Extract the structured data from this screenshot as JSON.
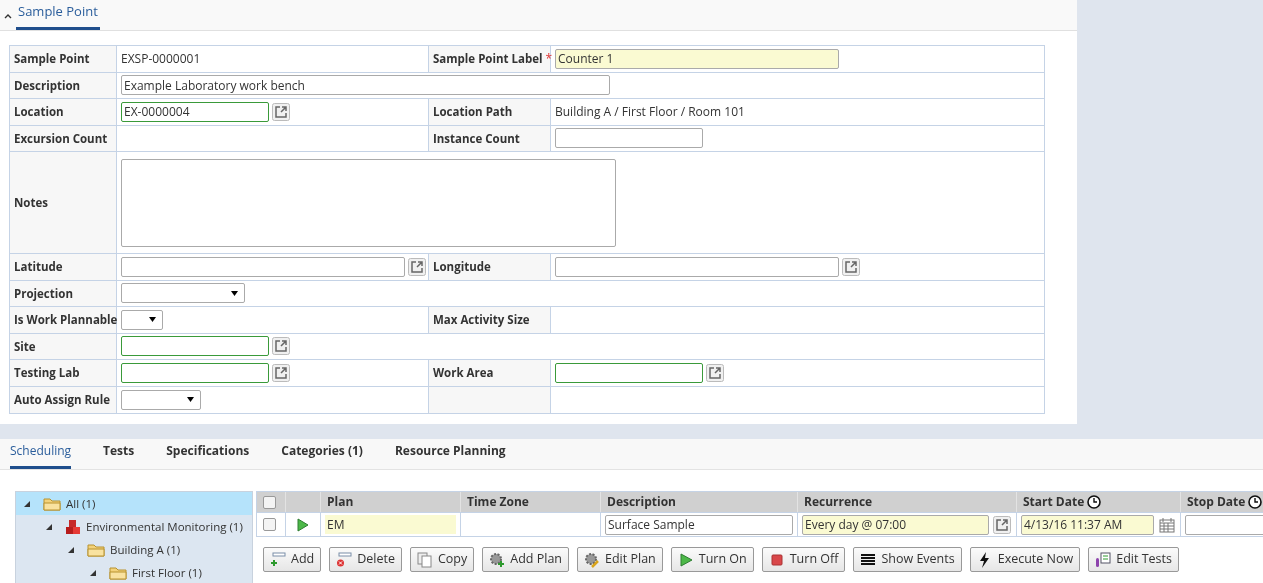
{
  "section": {
    "title": "Sample Point",
    "expanded": true
  },
  "form_rows": [
    {
      "full_width": false,
      "fields": [
        {
          "label": "Sample Point",
          "kind": "text",
          "value": "EXSP-0000001"
        },
        {
          "label": "Sample Point Label",
          "required_mark": "*",
          "kind": "wideinput",
          "value": "Counter 1",
          "required": true
        }
      ]
    },
    {
      "full_width": true,
      "fields": [
        {
          "label": "Description",
          "kind": "fullinput",
          "value": "Example Laboratory work bench"
        }
      ]
    },
    {
      "full_width": false,
      "fields": [
        {
          "label": "Location",
          "kind": "input",
          "value": "EX-0000004",
          "linked": true,
          "link_button": true
        },
        {
          "label": "Location Path",
          "kind": "text",
          "value": "Building A / First Floor / Room 101"
        }
      ]
    },
    {
      "full_width": false,
      "fields": [
        {
          "label": "Excursion Count",
          "kind": "text"
        },
        {
          "label": "Instance Count",
          "kind": "input"
        }
      ]
    },
    {
      "full_width": true,
      "fields": [
        {
          "label": "Notes",
          "kind": "memo"
        }
      ]
    },
    {
      "full_width": false,
      "fields": [
        {
          "label": "Latitude",
          "kind": "wideinput",
          "link_button": true
        },
        {
          "label": "Longitude",
          "kind": "wideinput",
          "link_button": true
        }
      ]
    },
    {
      "full_width": true,
      "fields": [
        {
          "label": "Projection",
          "kind": "select"
        }
      ]
    },
    {
      "full_width": false,
      "fields": [
        {
          "label": "Is Work Plannable",
          "kind": "shortselect"
        },
        {
          "label": "Max Activity Size",
          "kind": "text"
        }
      ]
    },
    {
      "full_width": true,
      "fields": [
        {
          "label": "Site",
          "kind": "input",
          "linked": true,
          "link_button": true
        }
      ]
    },
    {
      "full_width": false,
      "fields": [
        {
          "label": "Testing Lab",
          "kind": "input",
          "linked": true,
          "link_button": true
        },
        {
          "label": "Work Area",
          "kind": "input",
          "linked": true,
          "link_button": true
        }
      ]
    },
    {
      "full_width": false,
      "fields": [
        {
          "label": "Auto Assign Rule",
          "kind": "midselect"
        }
      ]
    }
  ],
  "tabs": [
    {
      "label": "Scheduling",
      "selected": true
    },
    {
      "label": "Tests",
      "selected": false
    },
    {
      "label": "Specifications",
      "selected": false
    },
    {
      "label": "Categories (1)",
      "selected": false
    },
    {
      "label": "Resource Planning",
      "selected": false
    }
  ],
  "tree": [
    {
      "label": "All (1)",
      "kind": "folder",
      "selected": true,
      "expanded": true,
      "children": [
        {
          "label": "Environmental Monitoring (1)",
          "kind": "cubes",
          "selected": false,
          "expanded": true,
          "children": [
            {
              "label": "Building A (1)",
              "kind": "folder",
              "selected": false,
              "expanded": true,
              "children": [
                {
                  "label": "First Floor (1)",
                  "kind": "folder",
                  "selected": false,
                  "expanded": true
                }
              ]
            }
          ]
        }
      ]
    }
  ],
  "grid": {
    "columns": [
      {
        "kind": "checkbox",
        "checked": false
      },
      {
        "kind": "blank"
      },
      {
        "kind": "plain",
        "label": "Plan"
      },
      {
        "kind": "plain",
        "label": "Time Zone"
      },
      {
        "kind": "plain",
        "label": "Description"
      },
      {
        "kind": "plain",
        "label": "Recurrence"
      },
      {
        "kind": "clock",
        "label": "Start Date"
      },
      {
        "kind": "clock",
        "label": "Stop Date"
      }
    ],
    "rows": [
      {
        "checked": false,
        "active": true,
        "plan": "EM",
        "description": "Surface Sample",
        "recurrence": "Every day @ 07:00",
        "start_date": "4/13/16 11:37 AM"
      }
    ]
  },
  "buttons": [
    {
      "label": "Add",
      "kind": "add"
    },
    {
      "label": "Delete",
      "kind": "delete"
    },
    {
      "label": "Copy",
      "kind": "copy"
    },
    {
      "label": "Add Plan",
      "kind": "addplan"
    },
    {
      "label": "Edit Plan",
      "kind": "editplan"
    },
    {
      "label": "Turn On",
      "kind": "on"
    },
    {
      "label": "Turn Off",
      "kind": "off"
    },
    {
      "label": "Show Events",
      "kind": "events"
    },
    {
      "label": "Execute Now",
      "kind": "execute"
    },
    {
      "label": "Edit Tests",
      "kind": "tests"
    }
  ]
}
